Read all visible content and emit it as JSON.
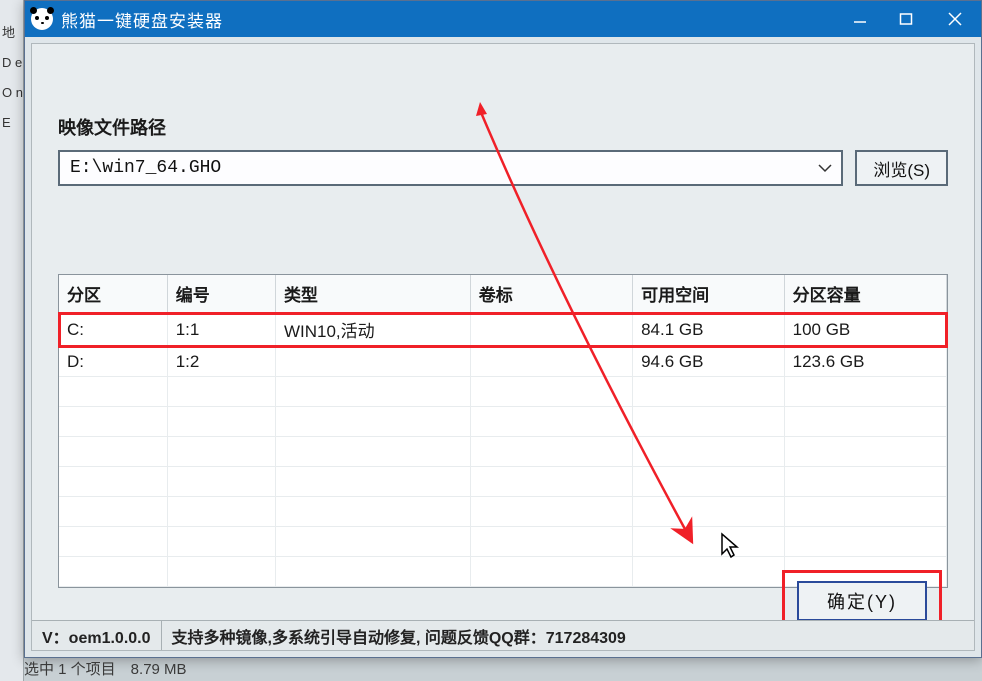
{
  "window": {
    "title": "熊猫一键硬盘安装器"
  },
  "path": {
    "label": "映像文件路径",
    "value": "E:\\win7_64.GHO",
    "browse": "浏览(S)"
  },
  "table": {
    "headers": {
      "partition": "分区",
      "number": "编号",
      "type": "类型",
      "label": "卷标",
      "free": "可用空间",
      "capacity": "分区容量"
    },
    "rows": [
      {
        "partition": "C:",
        "number": "1:1",
        "type": "WIN10,活动",
        "label": "",
        "free": "84.1 GB",
        "capacity": "100 GB"
      },
      {
        "partition": "D:",
        "number": "1:2",
        "type": "",
        "label": "",
        "free": "94.6 GB",
        "capacity": "123.6 GB"
      }
    ]
  },
  "confirm": {
    "label": "确定(Y)"
  },
  "statusbar": {
    "version": "V：oem1.0.0.0",
    "info": "支持多种镜像,多系统引导自动修复, 问题反馈QQ群：717284309"
  },
  "behind": {
    "fragment": "选中 1 个项目　8.79 MB",
    "sliver": "地\nD\ne\nO\nn\nE"
  }
}
